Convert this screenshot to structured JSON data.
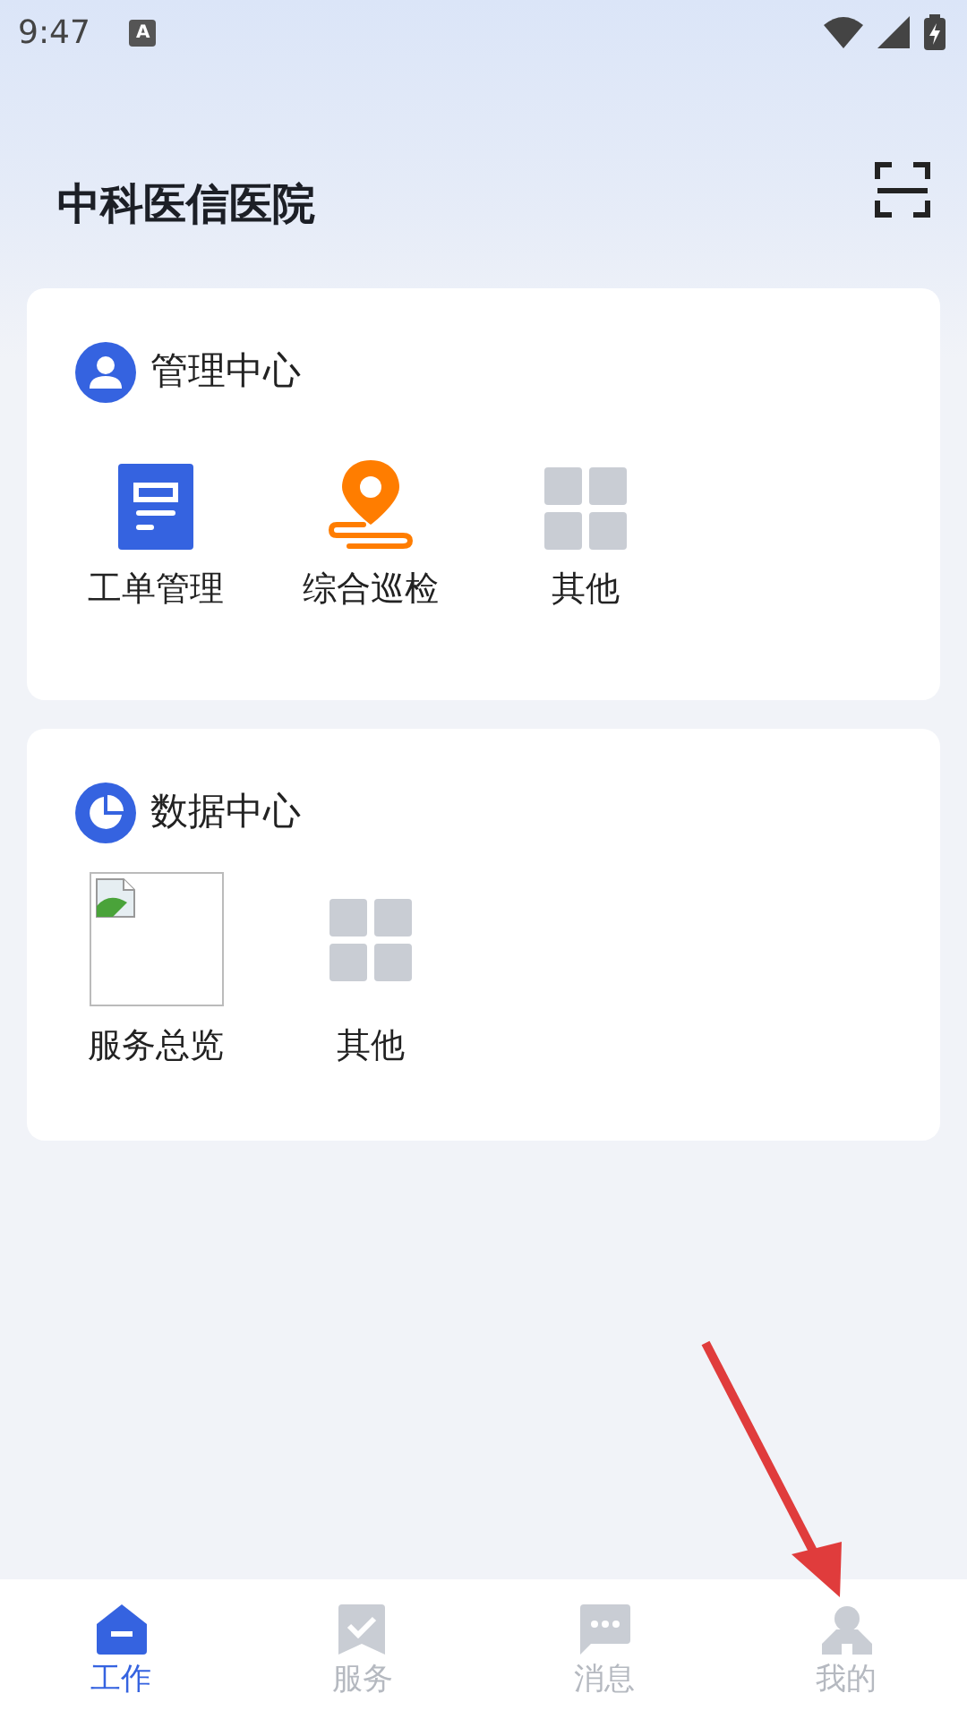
{
  "status_bar": {
    "time": "9:47",
    "notification": "A"
  },
  "header": {
    "title": "中科医信医院"
  },
  "sections": [
    {
      "title": "管理中心",
      "kind": "person",
      "items": [
        {
          "label": "工单管理",
          "kind": "document"
        },
        {
          "label": "综合巡检",
          "kind": "pin"
        },
        {
          "label": "其他",
          "kind": "grid"
        }
      ]
    },
    {
      "title": "数据中心",
      "kind": "pie",
      "items": [
        {
          "label": "服务总览",
          "kind": "picture"
        },
        {
          "label": "其他",
          "kind": "grid"
        }
      ]
    }
  ],
  "tabs": [
    {
      "label": "工作",
      "kind": "home",
      "selected": true
    },
    {
      "label": "服务",
      "kind": "check",
      "selected": false
    },
    {
      "label": "消息",
      "kind": "chat",
      "selected": false
    },
    {
      "label": "我的",
      "kind": "user",
      "selected": false
    }
  ]
}
